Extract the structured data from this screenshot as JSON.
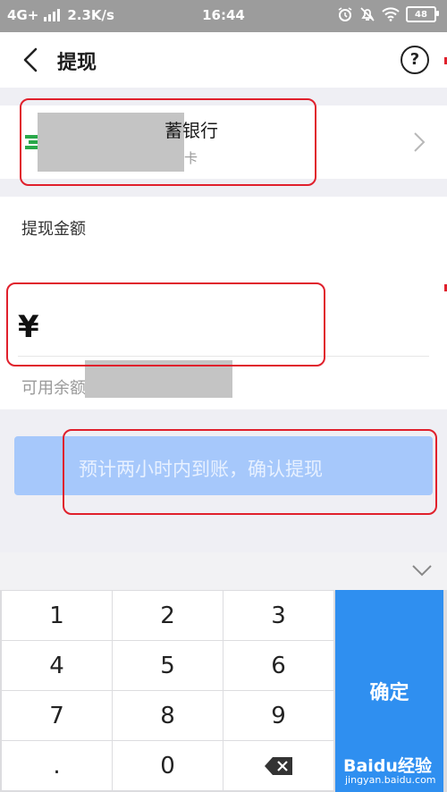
{
  "status_bar": {
    "network": "4G+",
    "speed": "2.3K/s",
    "time": "16:44",
    "battery": "48"
  },
  "header": {
    "title": "提现",
    "help_symbol": "?"
  },
  "bank": {
    "name_visible": "蓄银行",
    "sub_visible": "卡"
  },
  "amount": {
    "label": "提现金额",
    "currency_symbol": "¥",
    "value": "",
    "balance_label": "可用余额"
  },
  "confirm": {
    "label": "预计两小时内到账，确认提现"
  },
  "keyboard": {
    "keys": [
      "1",
      "2",
      "3",
      "4",
      "5",
      "6",
      "7",
      "8",
      "9",
      ".",
      "0"
    ],
    "ok_label": "确定"
  },
  "watermark": {
    "text": "Baidu经验",
    "sub": "jingyan.baidu.com"
  },
  "colors": {
    "accent": "#2f8ff0",
    "button_disabled": "#a6c8fb",
    "highlight": "#e0202c",
    "status_bar": "#9c9c9c"
  },
  "icons": [
    "back-arrow-icon",
    "help-icon",
    "bank-logo-icon",
    "chevron-right-icon",
    "chevron-down-icon",
    "backspace-icon",
    "signal-icon",
    "alarm-icon",
    "mute-icon",
    "wifi-icon",
    "battery-icon"
  ]
}
